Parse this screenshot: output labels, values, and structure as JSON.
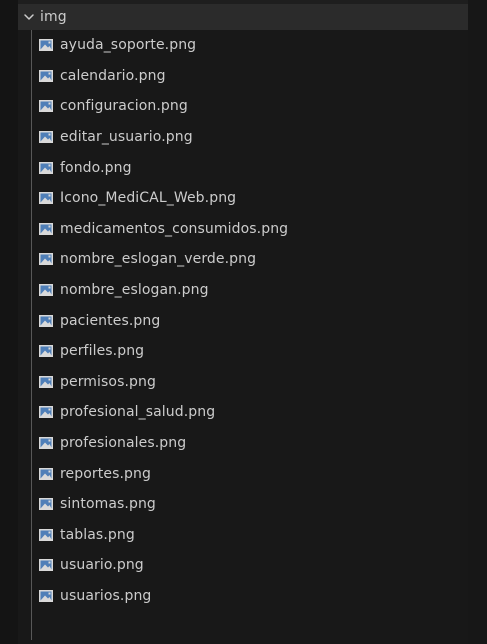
{
  "explorer": {
    "folder": {
      "label": "img",
      "chevron_icon": "chevron-down-icon",
      "expanded": true
    },
    "file_icon": "image-file-icon",
    "files": [
      {
        "label": "ayuda_soporte.png"
      },
      {
        "label": "calendario.png"
      },
      {
        "label": "configuracion.png"
      },
      {
        "label": "editar_usuario.png"
      },
      {
        "label": "fondo.png"
      },
      {
        "label": "Icono_MediCAL_Web.png"
      },
      {
        "label": "medicamentos_consumidos.png"
      },
      {
        "label": "nombre_eslogan_verde.png"
      },
      {
        "label": "nombre_eslogan.png"
      },
      {
        "label": "pacientes.png"
      },
      {
        "label": "perfiles.png"
      },
      {
        "label": "permisos.png"
      },
      {
        "label": "profesional_salud.png"
      },
      {
        "label": "profesionales.png"
      },
      {
        "label": "reportes.png"
      },
      {
        "label": "sintomas.png"
      },
      {
        "label": "tablas.png"
      },
      {
        "label": "usuario.png"
      },
      {
        "label": "usuarios.png"
      }
    ]
  },
  "colors": {
    "background": "#1e1e1e",
    "explorer_background": "#181818",
    "folder_row_background": "#2b2b2b",
    "text": "#cccccc",
    "image_icon_frame": "#d9d9d9",
    "image_icon_fill": "#4f7fb8",
    "indent_guide": "#585858"
  }
}
